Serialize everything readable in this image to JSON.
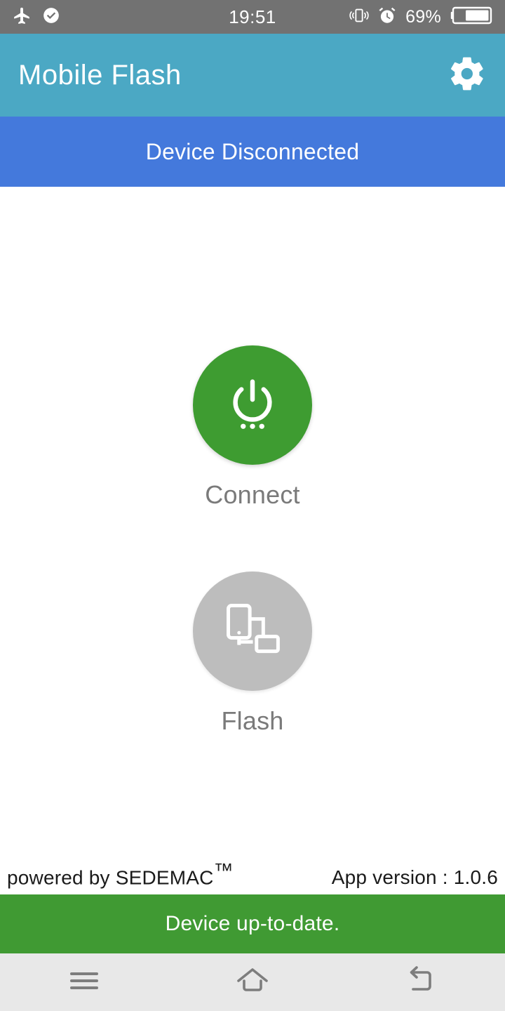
{
  "status_bar": {
    "time": "19:51",
    "battery_percent": "69%",
    "icons": [
      "airplane-mode-icon",
      "check-circle-icon",
      "vibrate-icon",
      "alarm-icon",
      "battery-icon"
    ],
    "background_color": "#727272"
  },
  "app_bar": {
    "title": "Mobile Flash",
    "settings_icon": "gear-icon",
    "background_color": "#4ba8c4"
  },
  "connection_banner": {
    "text": "Device Disconnected",
    "background_color": "#4479dc"
  },
  "actions": [
    {
      "key": "connect",
      "label": "Connect",
      "icon": "power-icon",
      "state": "enabled",
      "color": "#3e9c31"
    },
    {
      "key": "flash",
      "label": "Flash",
      "icon": "device-transfer-icon",
      "state": "disabled",
      "color": "#bdbdbd"
    }
  ],
  "footer": {
    "powered_by": "powered by SEDEMAC",
    "trademark": "™",
    "app_version": "App version : 1.0.6"
  },
  "update_banner": {
    "text": "Device up-to-date.",
    "background_color": "#409a33"
  },
  "nav_bar": {
    "buttons": [
      {
        "key": "recents",
        "icon": "menu-icon"
      },
      {
        "key": "home",
        "icon": "home-icon"
      },
      {
        "key": "back",
        "icon": "back-icon"
      }
    ],
    "background_color": "#e8e8e8"
  }
}
